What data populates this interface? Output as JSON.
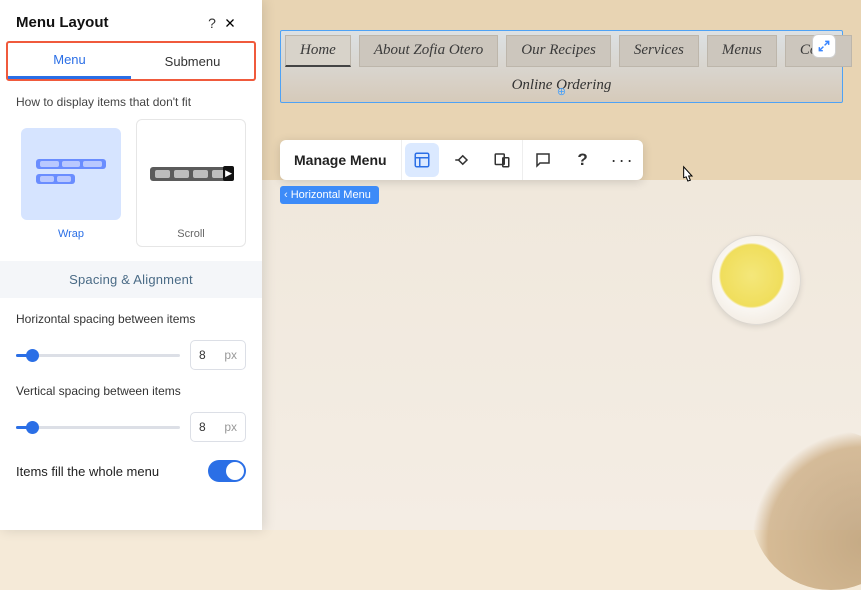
{
  "panel": {
    "title": "Menu Layout",
    "tabs": {
      "menu": "Menu",
      "submenu": "Submenu",
      "active": "menu"
    },
    "overflow": {
      "note": "How to display items that don't fit",
      "options": {
        "wrap": "Wrap",
        "scroll": "Scroll",
        "selected": "wrap"
      }
    },
    "spacing": {
      "heading": "Spacing & Alignment",
      "h": {
        "label": "Horizontal spacing between items",
        "value": "8",
        "unit": "px"
      },
      "v": {
        "label": "Vertical spacing between items",
        "value": "8",
        "unit": "px"
      }
    },
    "fill": {
      "label": "Items fill the whole menu",
      "on": true
    }
  },
  "floatbar": {
    "manage": "Manage Menu"
  },
  "breadcrumb": "Horizontal Menu",
  "nav": {
    "items": [
      "Home",
      "About Zofia Otero",
      "Our Recipes",
      "Services",
      "Menus",
      "Conta"
    ],
    "online": "Online Ordering"
  }
}
